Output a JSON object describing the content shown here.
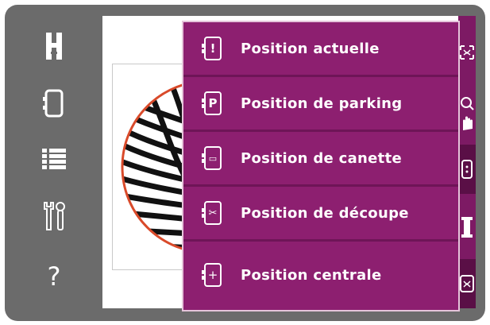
{
  "left_toolbar": {
    "items": [
      {
        "icon": "embroidery-unit-icon"
      },
      {
        "icon": "hoop-icon"
      },
      {
        "icon": "menu-list-icon"
      },
      {
        "icon": "tools-icon"
      },
      {
        "icon": "help-icon",
        "glyph": "?"
      }
    ]
  },
  "position_menu": {
    "items": [
      {
        "icon": "current-position-icon",
        "glyph": "!",
        "label": "Position actuelle"
      },
      {
        "icon": "parking-position-icon",
        "glyph": "P",
        "label": "Position de parking"
      },
      {
        "icon": "bobbin-position-icon",
        "glyph": "▭",
        "label": "Position de canette"
      },
      {
        "icon": "cut-position-icon",
        "glyph": "✂",
        "label": "Position de découpe"
      },
      {
        "icon": "center-position-icon",
        "glyph": "+",
        "label": "Position centrale"
      }
    ]
  },
  "right_strip": {
    "items": [
      {
        "icon": "zoom-fit-icon"
      },
      {
        "icon": "zoom-pan-icon"
      },
      {
        "icon": "hoop-position-icon",
        "active": true
      },
      {
        "icon": "thread-spool-icon"
      },
      {
        "icon": "design-view-icon",
        "active": true
      }
    ]
  },
  "colors": {
    "menu_bg": "#8d1f70",
    "menu_divider": "#6e1557",
    "strip_bg": "#7d1a64",
    "device_bg": "#6b6b6b",
    "hoop_outline": "#d94a2a"
  }
}
